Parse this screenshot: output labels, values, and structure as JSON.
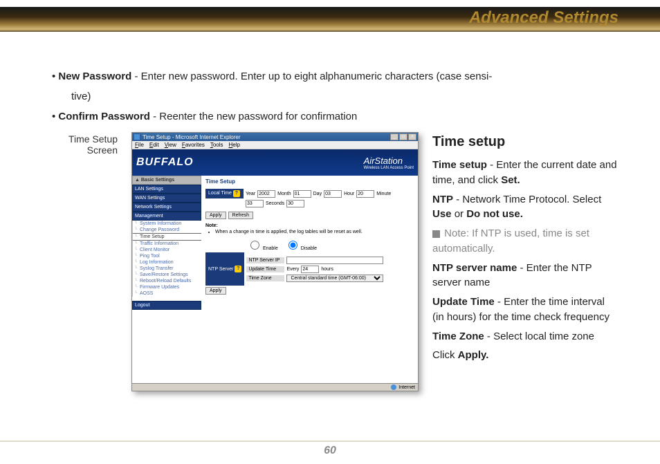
{
  "header": {
    "title": "Advanced Settings"
  },
  "bullets": {
    "b1_bold": "New Password",
    "b1_rest": " - Enter new password.  Enter up to eight alphanumeric characters (case sensi-",
    "b1_cont": "tive)",
    "b2_bold": "Confirm Password",
    "b2_rest": " - Reenter the new password for confirmation"
  },
  "caption": {
    "l1": "Time Setup",
    "l2": "Screen"
  },
  "screenshot": {
    "window_title": "Time Setup - Microsoft Internet Explorer",
    "menus": [
      "File",
      "Edit",
      "View",
      "Favorites",
      "Tools",
      "Help"
    ],
    "brand": "BUFFALO",
    "product": "AirStation",
    "product_sub": "Wireless LAN Access Point",
    "sidebar": {
      "basic": "▲ Basic Settings",
      "lan": "LAN Settings",
      "wan": "WAN Settings",
      "net": "Network Settings",
      "mgmt": "Management",
      "items": [
        "System Information",
        "Change Password",
        "Time Setup",
        "Traffic Information",
        "Client Monitor",
        "Ping Tool",
        "Log Information",
        "Syslog Transfer",
        "Save/Restore Settings",
        "Reboot/Reload Defaults",
        "Firmware Updates",
        "AOSS"
      ],
      "logout": "Logout"
    },
    "panel": {
      "title": "Time Setup",
      "local_time": "Local Time",
      "year_l": "Year",
      "year_v": "2002",
      "month_l": "Month",
      "month_v": "01",
      "day_l": "Day",
      "day_v": "03",
      "hour_l": "Hour",
      "hour_v": "20",
      "minute_l": "Minute",
      "minute_v": "33",
      "seconds_l": "Seconds",
      "seconds_v": "30",
      "apply": "Apply",
      "refresh": "Refresh",
      "note_h": "Note:",
      "note_t": "When a change in time is applied, the log tables will be reset as well.",
      "enable": "Enable",
      "disable": "Disable",
      "ntp_server": "NTP Server",
      "ntp_ip": "NTP Server IP",
      "update_time": "Update Time",
      "every": "Every",
      "hours_v": "24",
      "hours_l": "hours",
      "tz_l": "Time Zone",
      "tz_v": "Central standard time (GMT-06:00)"
    },
    "status": "Internet"
  },
  "right": {
    "heading": "Time setup",
    "p1a": "Time setup",
    "p1b": " - Enter the current date and time, and click ",
    "p1c": "Set.",
    "p2a": "NTP",
    "p2b": " - Network Time Protocol.  Select ",
    "p2c": "Use",
    "p2d": " or ",
    "p2e": "Do not use.",
    "note": " Note: If NTP is used, time is set automatically.",
    "p3a": "NTP server name",
    "p3b": " - Enter the NTP server name",
    "p4a": "Update Time",
    "p4b": " - Enter the time interval (in hours) for the time check frequency",
    "p5a": "Time Zone",
    "p5b": " - Select local time zone",
    "p6a": "Click ",
    "p6b": "Apply."
  },
  "page_number": "60"
}
